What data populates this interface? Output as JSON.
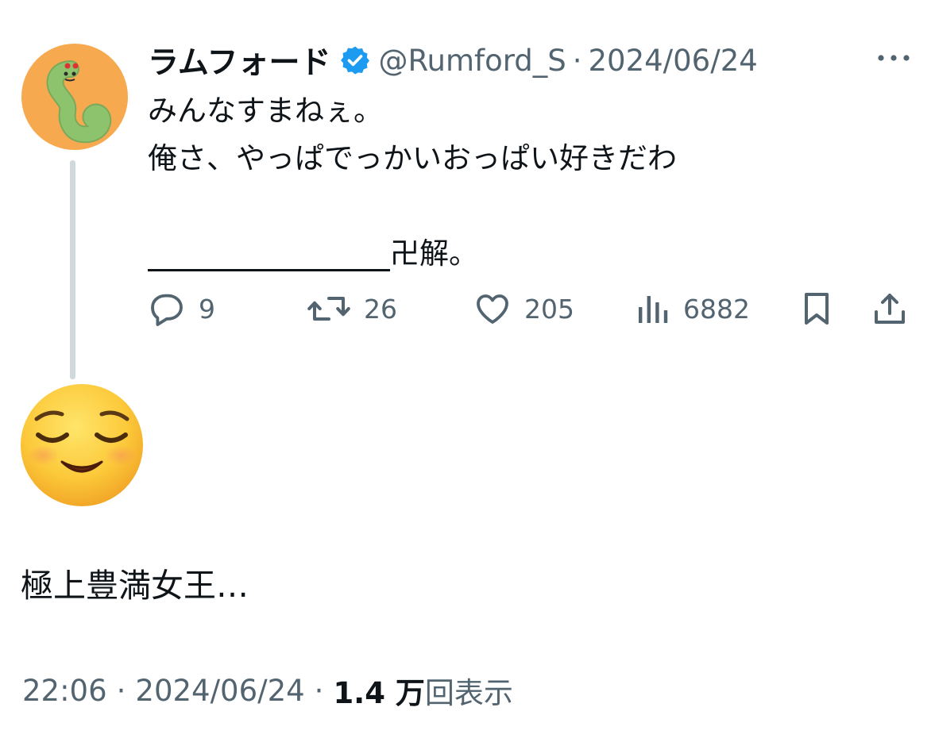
{
  "parent_tweet": {
    "display_name": "ラムフォード",
    "handle": "@Rumford_S",
    "separator": "·",
    "date": "2024/06/24",
    "lines": [
      "みんなすまねぇ。",
      "俺さ、やっぱでっかいおっぱい好きだわ",
      "",
      "卍解。"
    ],
    "actions": {
      "replies": "9",
      "retweets": "26",
      "likes": "205",
      "views": "6882"
    },
    "icons": {
      "verified": "verified-badge-icon",
      "more": "more-options-icon",
      "reply": "reply-icon",
      "retweet": "retweet-icon",
      "like": "heart-icon",
      "views": "analytics-icon",
      "bookmark": "bookmark-icon",
      "share": "share-icon"
    }
  },
  "reply_tweet": {
    "text": "極上豊満女王…",
    "time": "22:06",
    "separator": "·",
    "date": "2024/06/24",
    "views_count": "1.4 万",
    "views_label": "回表示"
  },
  "colors": {
    "text_primary": "#0f1419",
    "text_secondary": "#536471",
    "verified_blue": "#1d9bf0",
    "thread_line": "#cfd9de",
    "avatar_bg": "#f6a94f",
    "avatar_character": "#8ec36e"
  }
}
